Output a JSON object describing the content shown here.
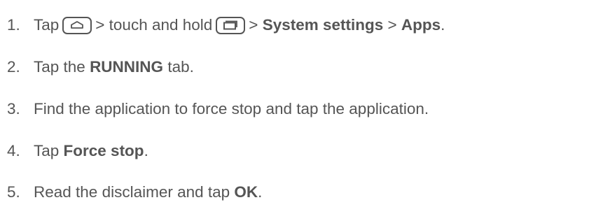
{
  "steps": [
    {
      "number": "1.",
      "parts": {
        "a": "Tap",
        "b": "> touch and hold",
        "c": "> ",
        "d": "System settings",
        "e": " > ",
        "f": "Apps",
        "g": "."
      },
      "icons": [
        "home-key-icon",
        "recent-apps-key-icon"
      ]
    },
    {
      "number": "2.",
      "parts": {
        "a": "Tap the ",
        "b": "RUNNING",
        "c": " tab."
      }
    },
    {
      "number": "3.",
      "parts": {
        "a": "Find the application to force stop and tap the application."
      }
    },
    {
      "number": "4.",
      "parts": {
        "a": "Tap ",
        "b": "Force stop",
        "c": "."
      }
    },
    {
      "number": "5.",
      "parts": {
        "a": "Read the disclaimer and tap ",
        "b": "OK",
        "c": "."
      }
    }
  ],
  "colors": {
    "text": "#555555",
    "icon_stroke": "#555555"
  }
}
